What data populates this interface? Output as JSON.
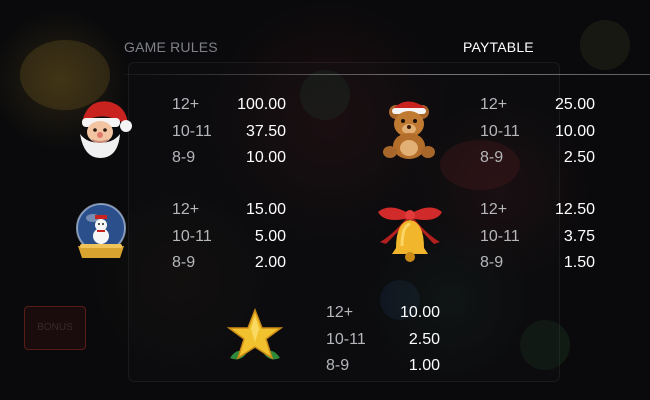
{
  "tabs": {
    "rules": "GAME RULES",
    "paytable": "PAYTABLE"
  },
  "paytable": [
    {
      "symbol": "santa-icon",
      "rows": [
        {
          "count": "12+",
          "value": "100.00"
        },
        {
          "count": "10-11",
          "value": "37.50"
        },
        {
          "count": "8-9",
          "value": "10.00"
        }
      ]
    },
    {
      "symbol": "teddy-bear-icon",
      "rows": [
        {
          "count": "12+",
          "value": "25.00"
        },
        {
          "count": "10-11",
          "value": "10.00"
        },
        {
          "count": "8-9",
          "value": "2.50"
        }
      ]
    },
    {
      "symbol": "snow-globe-icon",
      "rows": [
        {
          "count": "12+",
          "value": "15.00"
        },
        {
          "count": "10-11",
          "value": "5.00"
        },
        {
          "count": "8-9",
          "value": "2.00"
        }
      ]
    },
    {
      "symbol": "bell-icon",
      "rows": [
        {
          "count": "12+",
          "value": "12.50"
        },
        {
          "count": "10-11",
          "value": "3.75"
        },
        {
          "count": "8-9",
          "value": "1.50"
        }
      ]
    },
    {
      "symbol": "star-icon",
      "rows": [
        {
          "count": "12+",
          "value": "10.00"
        },
        {
          "count": "10-11",
          "value": "2.50"
        },
        {
          "count": "8-9",
          "value": "1.00"
        }
      ]
    }
  ]
}
